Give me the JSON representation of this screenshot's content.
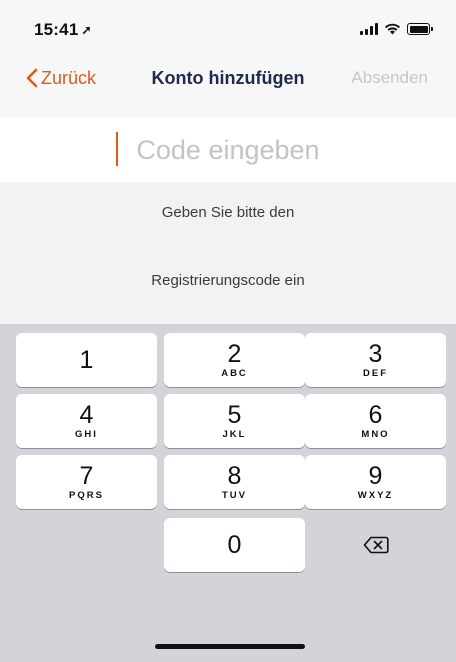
{
  "status_bar": {
    "time": "15:41",
    "location_icon": "location-arrow-icon",
    "icons": [
      "signal-icon",
      "wifi-icon",
      "battery-icon"
    ]
  },
  "nav": {
    "back_label": "Zurück",
    "title": "Konto hinzufügen",
    "action_label": "Absenden"
  },
  "code_input": {
    "placeholder": "Code eingeben",
    "value": ""
  },
  "info": {
    "line1": "Geben Sie bitte den",
    "line2": "Registrierungscode ein"
  },
  "keypad": {
    "keys": [
      {
        "digit": "1",
        "letters": ""
      },
      {
        "digit": "2",
        "letters": "ABC"
      },
      {
        "digit": "3",
        "letters": "DEF"
      },
      {
        "digit": "4",
        "letters": "GHI"
      },
      {
        "digit": "5",
        "letters": "JKL"
      },
      {
        "digit": "6",
        "letters": "MNO"
      },
      {
        "digit": "7",
        "letters": "PQRS"
      },
      {
        "digit": "8",
        "letters": "TUV"
      },
      {
        "digit": "9",
        "letters": "WXYZ"
      },
      {
        "digit": "0",
        "letters": ""
      }
    ],
    "delete_icon": "backspace-icon"
  },
  "colors": {
    "accent": "#e05a1c",
    "title": "#1f2a4d",
    "disabled": "#c7c7cc",
    "keypad_bg": "#d2d4da"
  }
}
